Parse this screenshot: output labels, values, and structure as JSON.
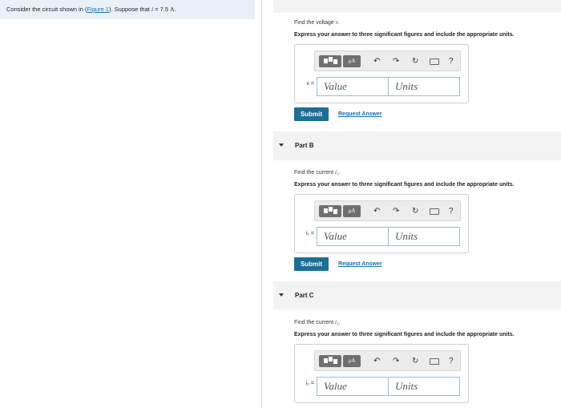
{
  "left": {
    "prompt_pre": "Consider the circuit shown in (",
    "figure_link": "Figure 1",
    "prompt_mid": "). Suppose that ",
    "var": "i",
    "prompt_eq": " = 7.5 ",
    "unit": "A",
    "prompt_end": "."
  },
  "toolbar": {
    "units_btn": "μA",
    "undo": "↶",
    "redo": "↷",
    "reset": "↻",
    "help": "?"
  },
  "partA": {
    "find_text": "Find the voltage ",
    "find_var": "v",
    "instr": "Express your answer to three significant figures and include the appropriate units.",
    "var_label": "v =",
    "value_placeholder": "Value",
    "units_placeholder": "Units",
    "submit": "Submit",
    "request": "Request Answer"
  },
  "partB": {
    "title": "Part B",
    "find_text": "Find the current ",
    "find_var": "i₁",
    "instr": "Express your answer to three significant figures and include the appropriate units.",
    "var_label": "i₁ =",
    "value_placeholder": "Value",
    "units_placeholder": "Units",
    "submit": "Submit",
    "request": "Request Answer"
  },
  "partC": {
    "title": "Part C",
    "find_text": "Find the current ",
    "find_var": "i₂",
    "instr": "Express your answer to three significant figures and include the appropriate units.",
    "var_label": "i₂ =",
    "value_placeholder": "Value",
    "units_placeholder": "Units"
  }
}
